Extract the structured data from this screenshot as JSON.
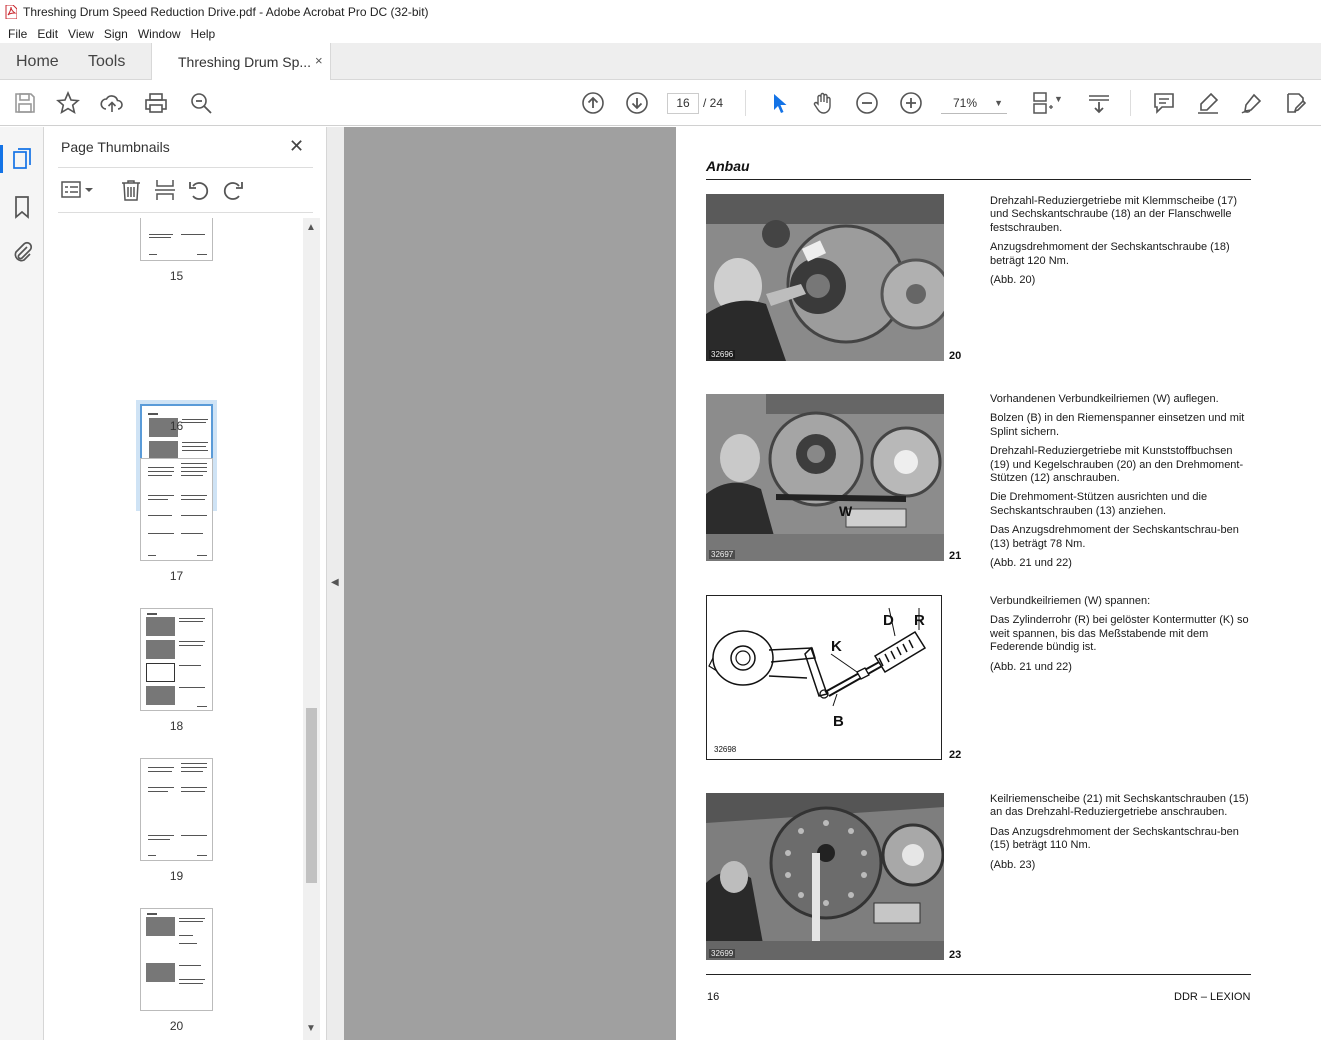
{
  "window": {
    "title": "Threshing Drum Speed Reduction Drive.pdf - Adobe Acrobat Pro DC (32-bit)"
  },
  "menu": [
    "File",
    "Edit",
    "View",
    "Sign",
    "Window",
    "Help"
  ],
  "tabs": {
    "home": "Home",
    "tools": "Tools",
    "document": "Threshing Drum Sp...",
    "close": "×"
  },
  "toolbar": {
    "current_page": "16",
    "total_pages": "/ 24",
    "zoom": "71%",
    "icons": [
      "save-icon",
      "bookmark-star-icon",
      "upload-icon",
      "print-icon",
      "find-icon",
      "page-up-icon",
      "page-down-icon",
      "select-arrow-icon",
      "hand-icon",
      "zoom-out-icon",
      "zoom-in-icon",
      "page-fit-icon",
      "scroll-mode-icon",
      "comment-icon",
      "highlight-icon",
      "sign-icon",
      "edit-pdf-icon"
    ]
  },
  "panel": {
    "title": "Page Thumbnails",
    "close": "✕",
    "thumbnails": [
      {
        "num": "15",
        "selected": false
      },
      {
        "num": "16",
        "selected": true
      },
      {
        "num": "17",
        "selected": false
      },
      {
        "num": "18",
        "selected": false
      },
      {
        "num": "19",
        "selected": false
      },
      {
        "num": "20",
        "selected": false
      }
    ]
  },
  "page": {
    "heading": "Anbau",
    "footer_left": "16",
    "footer_right": "DDR – LEXION",
    "figures": [
      {
        "code": "32696",
        "num": "20",
        "paragraphs": [
          "Drehzahl-Reduziergetriebe mit Klemmscheibe (17) und Sechskantschraube (18) an der Flanschwelle festschrauben.",
          "Anzugsdrehmoment der Sechskantschraube (18) beträgt 120 Nm.",
          "(Abb. 20)"
        ]
      },
      {
        "code": "32697",
        "num": "21",
        "label": "W",
        "paragraphs": [
          "Vorhandenen Verbundkeilriemen (W) auflegen.",
          "Bolzen (B) in den Riemenspanner einsetzen und mit Splint sichern.",
          "Drehzahl-Reduziergetriebe mit Kunststoffbuchsen (19) und Kegelschrauben (20) an den Drehmoment-Stützen (12) anschrauben.",
          "Die Drehmoment-Stützen ausrichten und die Sechskantschrauben (13) anziehen.",
          "Das Anzugsdrehmoment der Sechskantschrau-ben (13) beträgt 78 Nm.",
          "(Abb. 21 und 22)"
        ]
      },
      {
        "code": "32698",
        "num": "22",
        "labels": {
          "d": "D",
          "r": "R",
          "k": "K",
          "b": "B"
        },
        "paragraphs": [
          "Verbundkeilriemen (W) spannen:",
          "Das Zylinderrohr (R) bei gelöster Kontermutter (K) so weit spannen, bis das Meßstabende mit dem Federende bündig ist.",
          "(Abb. 21 und 22)"
        ]
      },
      {
        "code": "32699",
        "num": "23",
        "paragraphs": [
          "Keilriemenscheibe (21) mit Sechskantschrauben (15) an das Drehzahl-Reduziergetriebe anschrauben.",
          "Das Anzugsdrehmoment der Sechskantschrau-ben (15) beträgt 110 Nm.",
          "(Abb. 23)"
        ]
      }
    ]
  }
}
